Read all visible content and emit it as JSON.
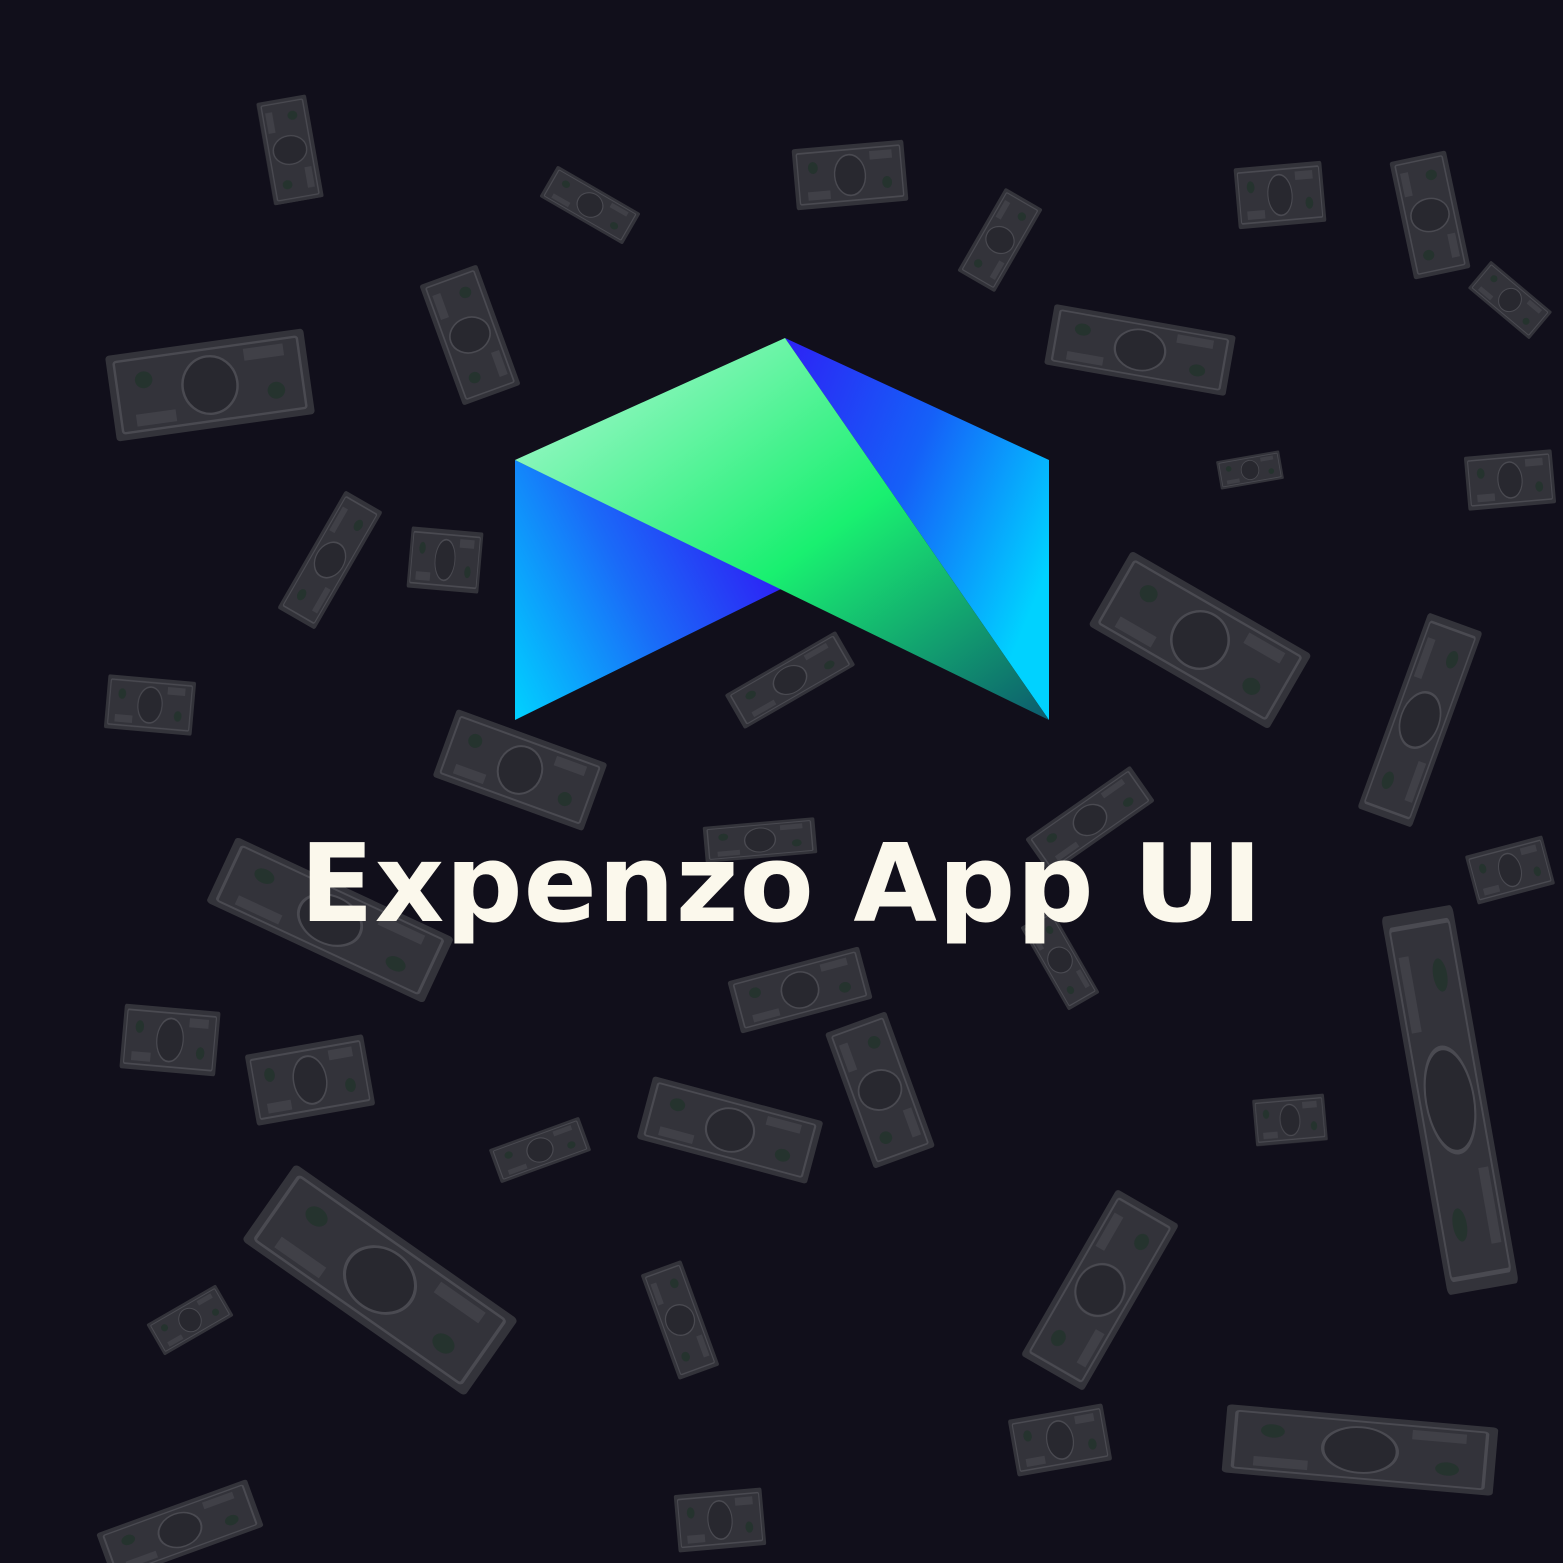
{
  "title": "Expenzo App UI",
  "colors": {
    "background": "#110f1b",
    "title": "#fbf8ec",
    "bill": "#3a3a40",
    "logo_light_green": "#a7f7d0",
    "logo_green": "#19f070",
    "logo_blue": "#2d22f5",
    "logo_cyan": "#00d2ff"
  },
  "icons": {
    "logo": "expenzo-logo-icon",
    "background": "falling-money-bills"
  }
}
